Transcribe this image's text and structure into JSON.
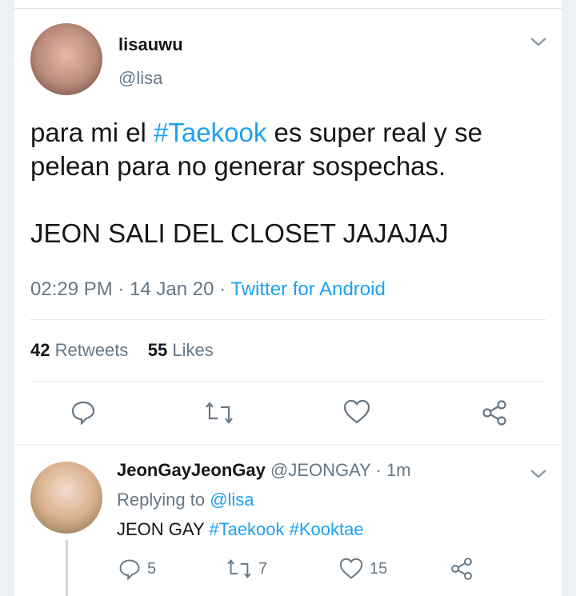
{
  "tweet": {
    "display_name": "lisauwu",
    "handle": "@lisa",
    "text_before": "para mi el ",
    "hashtag": "#Taekook",
    "text_after": " es super real y se pelean para no generar sospechas.",
    "text_line3": "JEON SALI DEL CLOSET JAJAJAJ",
    "time": "02:29 PM",
    "sep1": " · ",
    "date": "14 Jan 20",
    "sep2": " · ",
    "source": "Twitter for Android",
    "retweets_count": "42",
    "retweets_label": " Retweets",
    "likes_count": "55",
    "likes_label": " Likes"
  },
  "reply": {
    "display_name": "JeonGayJeonGay",
    "handle": " @JEONGAY · 1m",
    "replying_prefix": "Replying to ",
    "replying_mention": "@lisa",
    "text": "JEON GAY ",
    "hashtag1": "#Taekook",
    "space": " ",
    "hashtag2": "#Kooktae",
    "reply_count": "5",
    "retweet_count": "7",
    "like_count": "15"
  },
  "colors": {
    "accent": "#1da1f2",
    "muted": "#657786",
    "text": "#14171a"
  }
}
